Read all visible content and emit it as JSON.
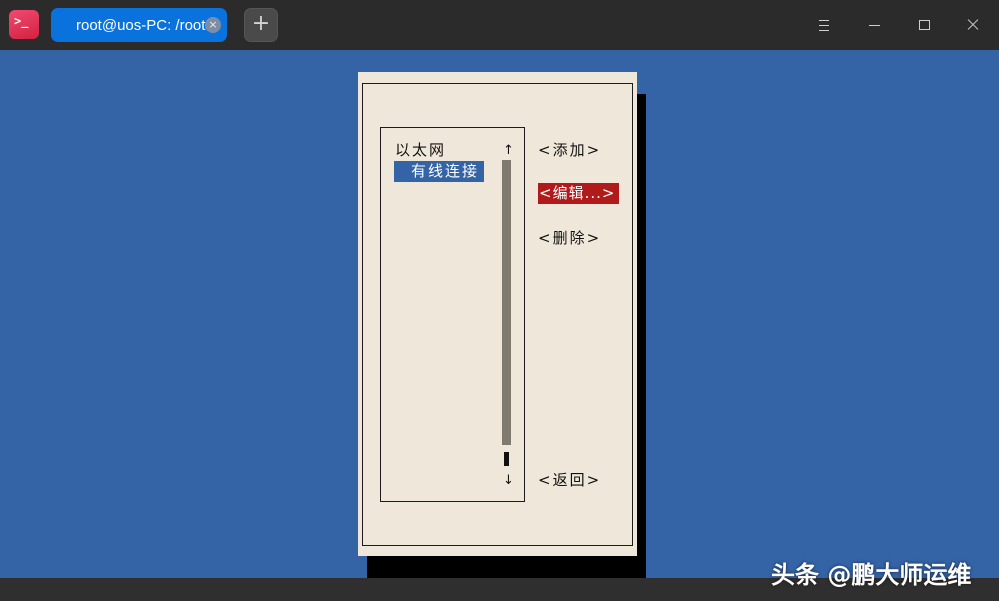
{
  "window": {
    "app_icon_glyph": ">_",
    "tab_title": "root@uos-PC: /root",
    "tab_close_glyph": "×",
    "new_tab_glyph": "+",
    "icons": [
      "terminal-app-icon",
      "tab-close-icon",
      "new-tab-icon",
      "menu-icon",
      "minimize-icon",
      "maximize-icon",
      "close-icon"
    ]
  },
  "dialog": {
    "list": {
      "group_label": "以太网",
      "selected_item": "有线连接",
      "scroll_up_glyph": "↑",
      "scroll_down_glyph": "↓"
    },
    "buttons": {
      "add": "<添加>",
      "edit": "<编辑...>",
      "delete": "<删除>",
      "back": "<返回>"
    }
  },
  "watermark": "头条 @鹏大师运维",
  "colors": {
    "terminal_bg": "#3463a6",
    "dialog_bg": "#efe8da",
    "selected_button": "#b11a1a",
    "tab_active": "#0a72dd",
    "titlebar": "#2b2b2b"
  }
}
